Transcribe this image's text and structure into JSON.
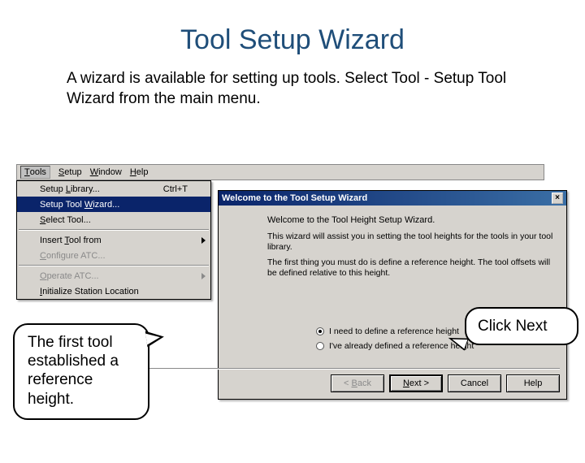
{
  "slide": {
    "title": "Tool Setup Wizard",
    "description": "A wizard is available for setting up tools. Select Tool - Setup Tool Wizard from the main menu."
  },
  "menubar": {
    "tools": "Tools",
    "setup": "Setup",
    "window": "Window",
    "help": "Help"
  },
  "menu": {
    "setup_library": "Setup Library...",
    "setup_library_accel": "Ctrl+T",
    "setup_tool_wizard": "Setup Tool Wizard...",
    "select_tool": "Select Tool...",
    "insert_tool_from": "Insert Tool from",
    "configure_atc": "Configure ATC...",
    "operate_atc": "Operate ATC...",
    "initialize_station": "Initialize Station Location"
  },
  "wizard": {
    "title": "Welcome to the Tool Setup Wizard",
    "intro": "Welcome to the Tool Height Setup Wizard.",
    "p1": "This wizard will assist you in setting the tool heights for the tools in your tool library.",
    "p2": "The first thing you must do is define a reference height. The tool offsets will be defined relative to this height.",
    "radio_need": "I need to define a reference height",
    "radio_have": "I've already defined a reference height",
    "back": "< Back",
    "next": "Next >",
    "cancel": "Cancel",
    "help": "Help"
  },
  "callouts": {
    "left": "The first tool established a reference height.",
    "right": "Click Next"
  }
}
